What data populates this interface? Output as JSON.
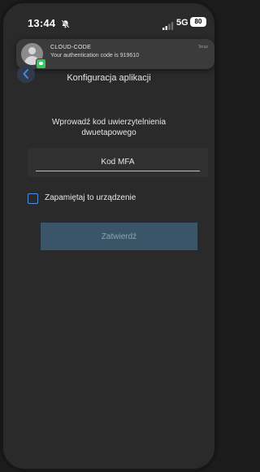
{
  "status_bar": {
    "time": "13:44",
    "network": "5G",
    "battery": "80"
  },
  "notification": {
    "app_name": "CLOUD-CODE",
    "message": "Your authentication code is 919610",
    "time": "Teraz"
  },
  "header": {
    "title": "Konfiguracja aplikacji"
  },
  "form": {
    "prompt": "Wprowadź kod uwierzytelnienia dwuetapowego",
    "mfa_placeholder": "Kod MFA",
    "mfa_value": "",
    "remember_label": "Zapamiętaj to urządzenie",
    "remember_checked": false,
    "confirm_label": "Zatwierdź"
  },
  "colors": {
    "background": "#2a2a2a",
    "accent": "#4a8fe0",
    "button_disabled": "#3a5568",
    "notification_badge": "#34c759"
  },
  "icons": [
    "bell-slash-icon",
    "signal-bars-icon",
    "battery-icon",
    "back-chevron-icon",
    "avatar-icon",
    "message-badge-icon"
  ]
}
